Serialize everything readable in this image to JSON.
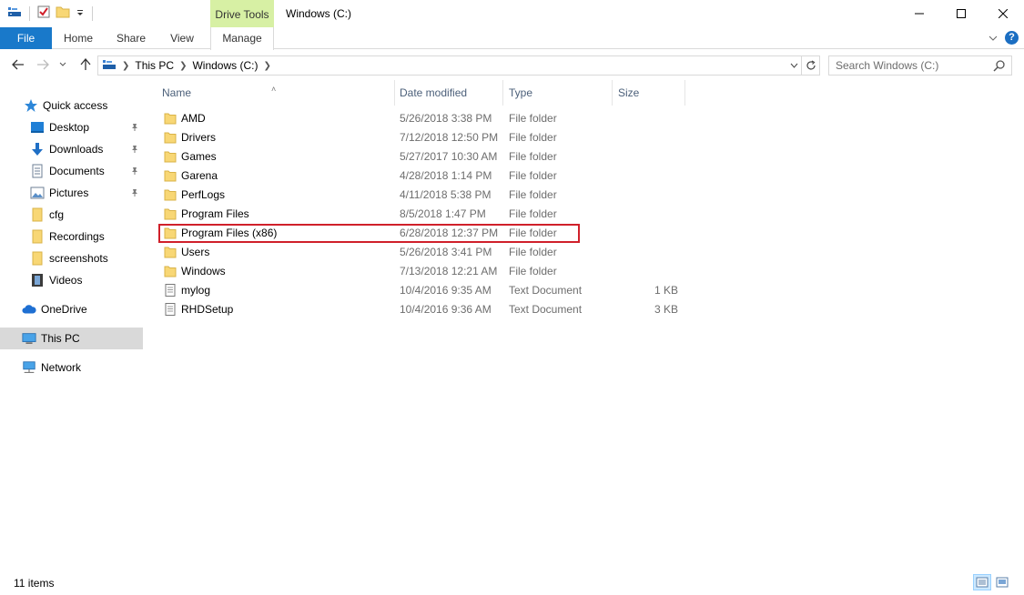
{
  "window": {
    "title": "Windows (C:)",
    "contextual_tab_group": "Drive Tools"
  },
  "ribbon": {
    "tabs": [
      "File",
      "Home",
      "Share",
      "View",
      "Manage"
    ]
  },
  "address_bar": {
    "crumbs": [
      "This PC",
      "Windows (C:)"
    ]
  },
  "search": {
    "placeholder": "Search Windows (C:)"
  },
  "sidebar": {
    "quick_access": "Quick access",
    "items": [
      {
        "label": "Desktop",
        "icon": "desktop-icon",
        "pinned": true
      },
      {
        "label": "Downloads",
        "icon": "download-arrow-icon",
        "pinned": true
      },
      {
        "label": "Documents",
        "icon": "documents-icon",
        "pinned": true
      },
      {
        "label": "Pictures",
        "icon": "pictures-icon",
        "pinned": true
      },
      {
        "label": "cfg",
        "icon": "folder-icon",
        "pinned": false
      },
      {
        "label": "Recordings",
        "icon": "folder-icon",
        "pinned": false
      },
      {
        "label": "screenshots",
        "icon": "folder-icon",
        "pinned": false
      },
      {
        "label": "Videos",
        "icon": "videos-icon",
        "pinned": false
      }
    ],
    "onedrive": "OneDrive",
    "this_pc": "This PC",
    "network": "Network"
  },
  "columns": {
    "name": "Name",
    "date": "Date modified",
    "type": "Type",
    "size": "Size"
  },
  "files": [
    {
      "name": "AMD",
      "date": "5/26/2018 3:38 PM",
      "type": "File folder",
      "size": "",
      "kind": "folder"
    },
    {
      "name": "Drivers",
      "date": "7/12/2018 12:50 PM",
      "type": "File folder",
      "size": "",
      "kind": "folder"
    },
    {
      "name": "Games",
      "date": "5/27/2017 10:30 AM",
      "type": "File folder",
      "size": "",
      "kind": "folder"
    },
    {
      "name": "Garena",
      "date": "4/28/2018 1:14 PM",
      "type": "File folder",
      "size": "",
      "kind": "folder"
    },
    {
      "name": "PerfLogs",
      "date": "4/11/2018 5:38 PM",
      "type": "File folder",
      "size": "",
      "kind": "folder"
    },
    {
      "name": "Program Files",
      "date": "8/5/2018 1:47 PM",
      "type": "File folder",
      "size": "",
      "kind": "folder"
    },
    {
      "name": "Program Files (x86)",
      "date": "6/28/2018 12:37 PM",
      "type": "File folder",
      "size": "",
      "kind": "folder"
    },
    {
      "name": "Users",
      "date": "5/26/2018 3:41 PM",
      "type": "File folder",
      "size": "",
      "kind": "folder"
    },
    {
      "name": "Windows",
      "date": "7/13/2018 12:21 AM",
      "type": "File folder",
      "size": "",
      "kind": "folder"
    },
    {
      "name": "mylog",
      "date": "10/4/2016 9:35 AM",
      "type": "Text Document",
      "size": "1 KB",
      "kind": "text"
    },
    {
      "name": "RHDSetup",
      "date": "10/4/2016 9:36 AM",
      "type": "Text Document",
      "size": "3 KB",
      "kind": "text"
    }
  ],
  "status": {
    "item_count": "11 items"
  },
  "colors": {
    "file_tab": "#1979ca",
    "drive_tools": "#d7f0a4",
    "highlight": "#d0202a",
    "folder": "#f8d775"
  }
}
